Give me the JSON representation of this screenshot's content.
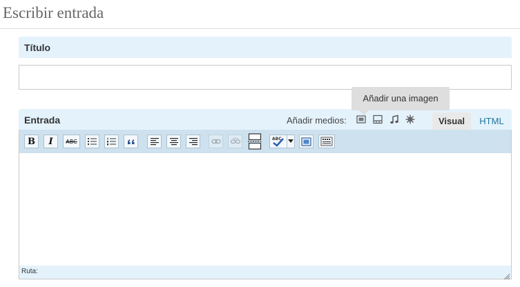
{
  "page": {
    "heading": "Escribir entrada"
  },
  "title_box": {
    "label": "Título",
    "input_value": ""
  },
  "tooltip": {
    "text": "Añadir una imagen"
  },
  "entry": {
    "label": "Entrada",
    "media_label": "Añadir medios:",
    "media_icons": [
      "add-image-icon",
      "add-gallery-icon",
      "add-audio-icon",
      "add-media-icon"
    ],
    "tabs": {
      "visual": "Visual",
      "html": "HTML"
    }
  },
  "toolbar": {
    "bold": "B",
    "italic": "I",
    "strikethrough": "ABC",
    "buttons": [
      "bold",
      "italic",
      "strikethrough",
      "bullet-list",
      "numbered-list",
      "blockquote",
      "align-left",
      "align-center",
      "align-right",
      "insert-link",
      "unlink",
      "insert-more",
      "spellcheck",
      "spellcheck-dropdown",
      "fullscreen",
      "toggle-kitchen-sink"
    ]
  },
  "statusbar": {
    "path_label": "Ruta:"
  },
  "colors": {
    "accent_blue": "#21759b",
    "header_bg": "#e4f2fc",
    "toolbar_bg": "#cee1ef"
  }
}
